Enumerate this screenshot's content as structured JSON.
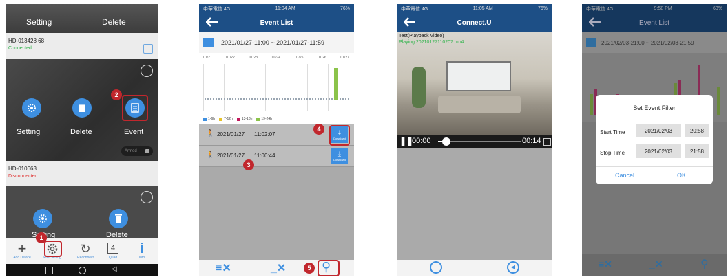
{
  "phone1": {
    "top_row": {
      "setting_label": "Setting",
      "delete_label": "Delete"
    },
    "camera1": {
      "id": "HD-013428 68",
      "status": "Connected",
      "status_color": "#2fb34a"
    },
    "actions": {
      "setting_label": "Setting",
      "delete_label": "Delete",
      "event_label": "Event",
      "armed_label": "Armed"
    },
    "camera2": {
      "id": "HD-010663",
      "status": "Disconnected",
      "status_color": "#e0302f"
    },
    "bottom_labels": {
      "setting": "Setting",
      "delete": "Delete"
    },
    "toolbar": {
      "add_device": "Add Device",
      "edit_setting": "Edit Setting",
      "reconnect": "Reconnect",
      "quad": "Quad",
      "quad_number": "4",
      "info": "Info"
    },
    "badges": {
      "one": "1",
      "two": "2"
    }
  },
  "phone2": {
    "status": {
      "carrier": "中華電信 4G",
      "time": "11:04 AM",
      "battery": "76%"
    },
    "title": "Event List",
    "date_range": "2021/01/27-11:00 ~ 2021/01/27-11:59",
    "chart_dates": [
      "01/21",
      "01/22",
      "01/23",
      "01/24",
      "01/25",
      "01/26",
      "01/27"
    ],
    "legend": [
      "1-6h",
      "7-12h",
      "13-18h",
      "19-24h"
    ],
    "legend_colors": [
      "#3e8fe0",
      "#e6c229",
      "#c2185b",
      "#8bc34a"
    ],
    "events": [
      {
        "date": "2021/01/27",
        "time": "11:02:07",
        "download": "Download"
      },
      {
        "date": "2021/01/27",
        "time": "11:00:44",
        "download": "Download"
      }
    ],
    "badges": {
      "three": "3",
      "four": "4",
      "five": "5"
    }
  },
  "phone3": {
    "status": {
      "carrier": "中華電信 4G",
      "time": "11:05 AM",
      "battery": "76%"
    },
    "title": "Connect.U",
    "video_title": "Test(Playback Video)",
    "video_file": "Playing 20210127110207.mp4",
    "time_current": "00:00",
    "time_total": "00:14"
  },
  "phone4": {
    "status": {
      "carrier": "中華電信 4G",
      "time": "9:58 PM",
      "battery": "63%"
    },
    "title": "Event List",
    "date_range": "2021/02/03-21:00 ~ 2021/02/03-21:59",
    "dialog": {
      "title": "Set Event Filter",
      "start_label": "Start Time",
      "start_date": "2021/02/03",
      "start_time": "20:58",
      "stop_label": "Stop Time",
      "stop_date": "2021/02/03",
      "stop_time": "21:58",
      "cancel": "Cancel",
      "ok": "OK"
    }
  }
}
